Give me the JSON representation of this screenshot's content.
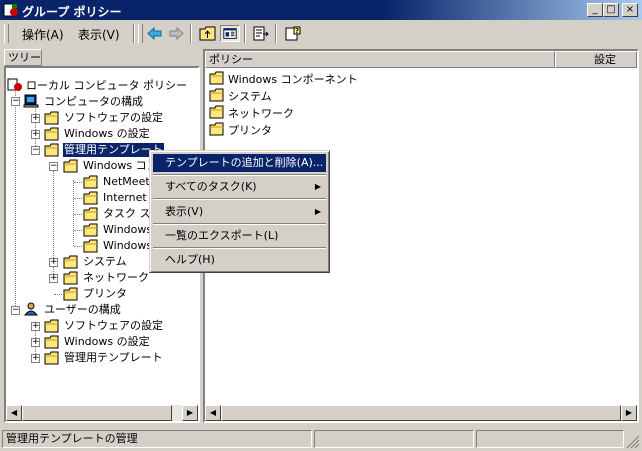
{
  "window": {
    "title": "グループ ポリシー",
    "controls": {
      "minimize": "_",
      "maximize": "□",
      "close": "×"
    }
  },
  "menubar": {
    "items": [
      "操作(A)",
      "表示(V)"
    ]
  },
  "toolbar": {
    "icons": [
      "back-arrow-icon",
      "forward-arrow-icon",
      "up-folder-icon",
      "show-hide-tree-icon",
      "export-list-icon",
      "help-icon"
    ]
  },
  "tree": {
    "header": "ツリー",
    "nodes": {
      "root": "ローカル コンピュータ ポリシー",
      "computer": "コンピュータの構成",
      "computer_software": "ソフトウェアの設定",
      "computer_windows": "Windows の設定",
      "admin_templates": "管理用テンプレート",
      "windows_components": "Windows コンポーネント",
      "netmeeting": "NetMeeting",
      "internet": "Internet Explorer",
      "task_scheduler": "タスク スケジューラ",
      "windows_installer": "Windows インストーラ",
      "windows_explorer": "Windows エクスプローラ",
      "system": "システム",
      "network": "ネットワーク",
      "printers": "プリンタ",
      "user": "ユーザーの構成",
      "user_software": "ソフトウェアの設定",
      "user_windows": "Windows の設定",
      "user_admin_templates": "管理用テンプレート"
    }
  },
  "list": {
    "columns": {
      "policy": "ポリシー",
      "setting": "設定"
    },
    "rows": [
      "Windows コンポーネント",
      "システム",
      "ネットワーク",
      "プリンタ"
    ]
  },
  "context_menu": {
    "items": {
      "add_remove": "テンプレートの追加と削除(A)...",
      "all_tasks": "すべてのタスク(K)",
      "view": "表示(V)",
      "export": "一覧のエクスポート(L)",
      "help": "ヘルプ(H)"
    }
  },
  "statusbar": {
    "text": "管理用テンプレートの管理"
  },
  "colors": {
    "title_start": "#0a246a",
    "title_end": "#a6caf0",
    "selection": "#0a246a",
    "face": "#d4d0c8",
    "folder": "#ffe680"
  }
}
